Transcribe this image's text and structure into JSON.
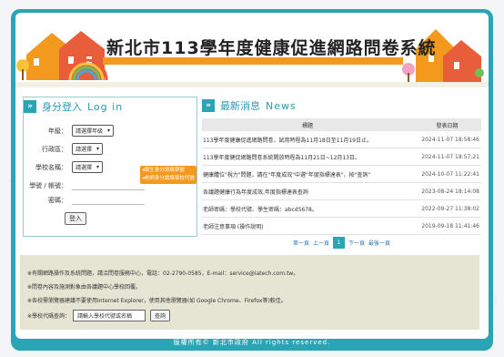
{
  "header": {
    "title": "新北市113學年度健康促進網路問卷系統"
  },
  "login": {
    "title": "身分登入",
    "subtitle": "Log in",
    "grade_label": "年級：",
    "grade_value": "請選擇年級",
    "district_label": "行政區：",
    "district_value": "請選擇",
    "school_label": "學校名稱：",
    "school_value": "請選擇",
    "student_label": "學號 / 帳號：",
    "password_label": "密碼：",
    "submit": "登入",
    "tip1": "◂學生身分請填學號",
    "tip2": "◂老師身分請填學校代號"
  },
  "news": {
    "title": "最新消息",
    "subtitle": "News",
    "col_title": "標題",
    "col_date": "發表日期",
    "rows": [
      {
        "title": "113學年度健康促進網路問卷，試用時程為11月18日至11月19日止。",
        "date": "2024-11-07 18:58:46"
      },
      {
        "title": "113學年度健促網路問卷系統開放時程為11月21日~12月13日。",
        "date": "2024-11-07 18:57:21"
      },
      {
        "title": "健康體位\"視力\"問題，請在\"年度成效\"中選\"年度指標達表\"，按\"查詢\"",
        "date": "2024-10-07 11:22:41"
      },
      {
        "title": "各議題健康行為年度成效,年度指標達表查詢",
        "date": "2023-08-24 18:14:08"
      },
      {
        "title": "老師密碼：學校代號、學生密碼：abcd5678。",
        "date": "2022-09-27 11:38:02"
      },
      {
        "title": "老師注意事項 (操作說明)",
        "date": "2019-09-18 11:41:46"
      }
    ]
  },
  "pager": {
    "first": "第一頁",
    "prev": "上一頁",
    "current": "1",
    "next": "下一頁",
    "last": "最後一頁"
  },
  "info": {
    "line1": "※有關網路操作及系統問題，請洽問卷服務中心，電話：02-2790-0585，E-mail：service@iatech.com.tw。",
    "line2": "※問卷內容及施測對象由各議題中心學校回覆。",
    "line3": "※各校需瀏覽器建議不要使用Internet Explorer，使用其他瀏覽器(如 Google Chrome、Firefox等)較佳。",
    "school_code_label": "※學校代碼查詢：",
    "school_code_placeholder": "請輸入學校代號或名稱",
    "query_button": "查詢"
  },
  "footer": {
    "text": "版權所有© 新北市政府 All rights reserved."
  },
  "colors": {
    "teal": "#2aa5b5",
    "orange": "#f39a1e",
    "info_bg": "#e6e4d2"
  }
}
